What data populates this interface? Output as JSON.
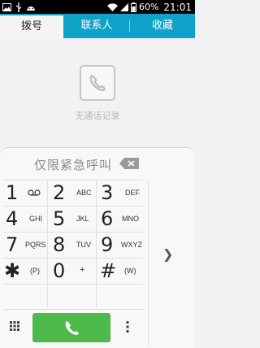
{
  "status_bar": {
    "battery": "60%",
    "time": "21:01",
    "icons": [
      "image-icon",
      "usb-icon",
      "android-icon",
      "wifi-icon",
      "signal-icon",
      "battery-icon"
    ]
  },
  "tabs": [
    {
      "label": "拨号",
      "active": true
    },
    {
      "label": "联系人",
      "active": false
    },
    {
      "label": "收藏",
      "active": false
    }
  ],
  "empty_state": {
    "icon": "phone-icon",
    "text": "无通话记录"
  },
  "dialpad": {
    "emergency_text": "仅限紧急呼叫",
    "keys": [
      {
        "digit": "1",
        "letters": "",
        "icon": "voicemail-icon"
      },
      {
        "digit": "2",
        "letters": "ABC"
      },
      {
        "digit": "3",
        "letters": "DEF"
      },
      {
        "digit": "4",
        "letters": "GHI"
      },
      {
        "digit": "5",
        "letters": "JKL"
      },
      {
        "digit": "6",
        "letters": "MNO"
      },
      {
        "digit": "7",
        "letters": "PQRS"
      },
      {
        "digit": "8",
        "letters": "TUV"
      },
      {
        "digit": "9",
        "letters": "WXYZ"
      },
      {
        "digit": "✱",
        "letters": "(P)"
      },
      {
        "digit": "0",
        "letters": "+"
      },
      {
        "digit": "#",
        "letters": "(W)"
      }
    ]
  },
  "colors": {
    "accent": "#0fa3c9",
    "call": "#4fb94a"
  }
}
